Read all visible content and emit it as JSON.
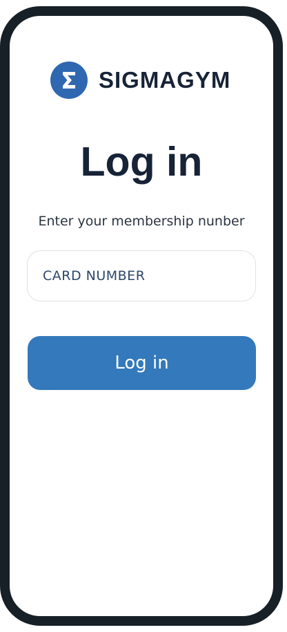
{
  "brand": {
    "logo_icon": "sigma-icon",
    "name": "SIGMAGYM",
    "color": "#2f68b1"
  },
  "login": {
    "title": "Log in",
    "subtitle": "Enter your membership nunber",
    "card_input": {
      "placeholder": "CARD NUMBER",
      "value": ""
    },
    "submit_label": "Log in",
    "button_color": "#3379bb"
  }
}
